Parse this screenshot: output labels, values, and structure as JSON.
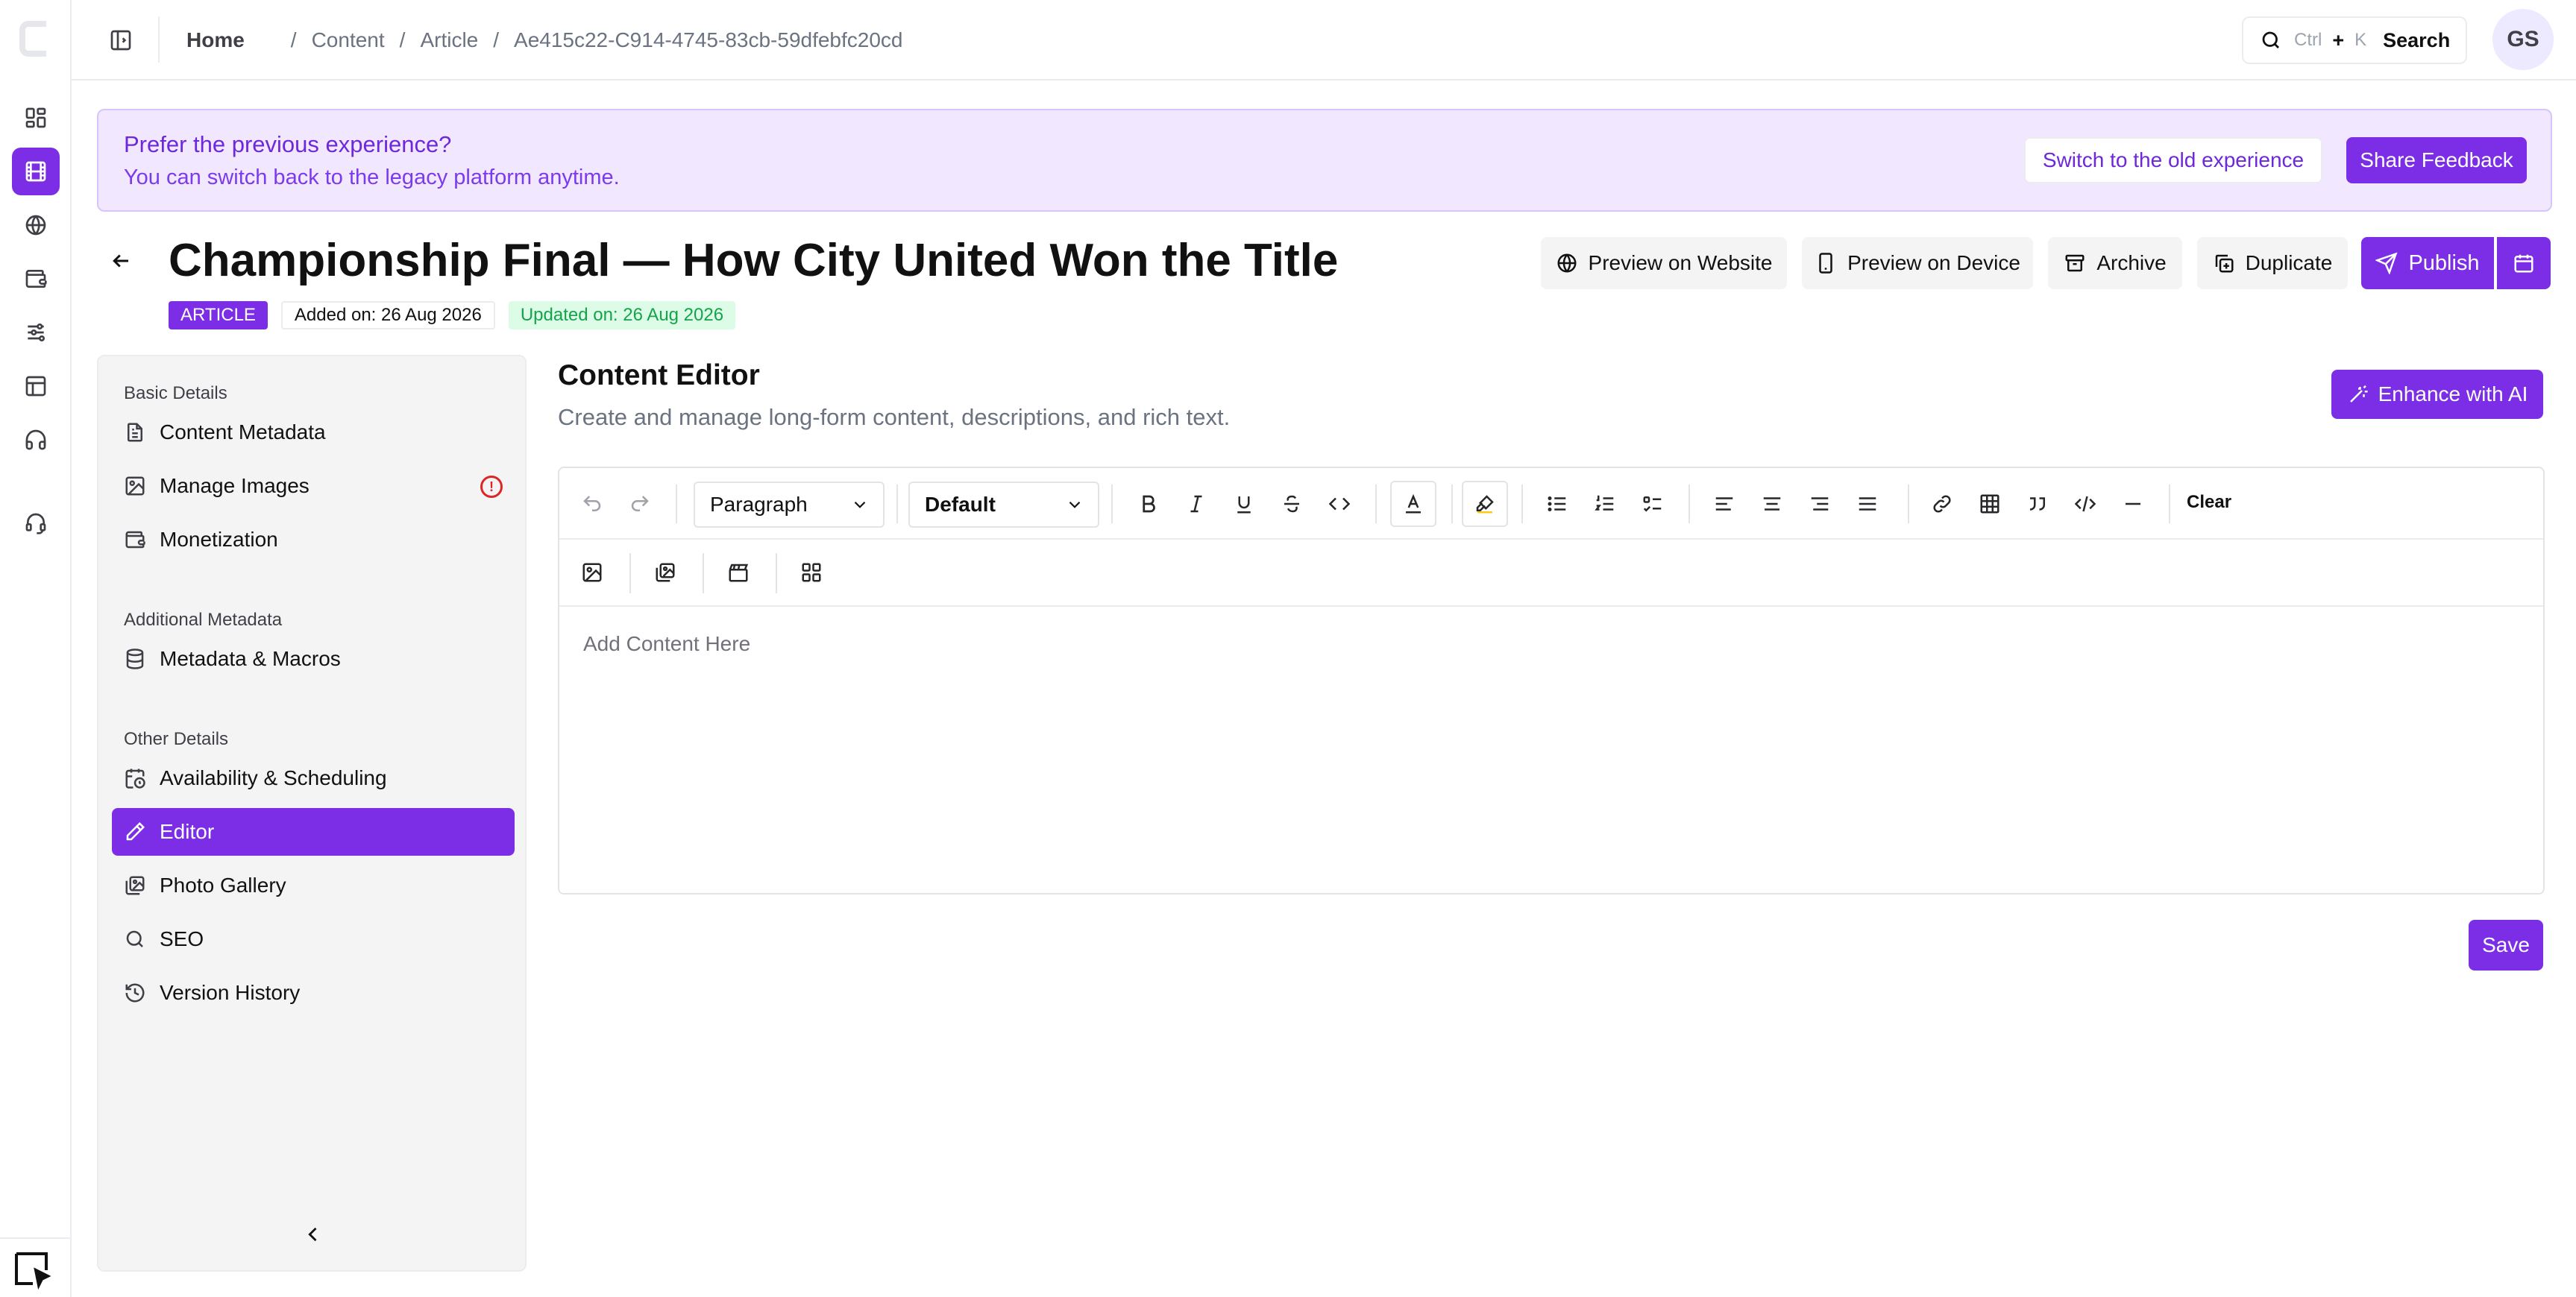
{
  "topbar": {
    "breadcrumb": [
      "Home",
      "Content",
      "Article",
      "Ae415c22-C914-4745-83cb-59dfebfc20cd"
    ],
    "search": {
      "key1": "Ctrl",
      "plus": "+",
      "key2": "K",
      "label": "Search"
    },
    "avatar_initials": "GS"
  },
  "banner": {
    "title": "Prefer the previous experience?",
    "subtitle": "You can switch back to the legacy platform anytime.",
    "switch_label": "Switch to the old experience",
    "feedback_label": "Share Feedback"
  },
  "page": {
    "title": "Championship Final — How City United Won the Title",
    "type_tag": "ARTICLE",
    "added": "Added on: 26 Aug 2026",
    "updated": "Updated on: 26 Aug 2026"
  },
  "actions": {
    "preview_website": "Preview on Website",
    "preview_device": "Preview on Device",
    "archive": "Archive",
    "duplicate": "Duplicate",
    "publish": "Publish"
  },
  "nav": {
    "basic_heading": "Basic Details",
    "basic": [
      "Content Metadata",
      "Manage Images",
      "Monetization"
    ],
    "additional_heading": "Additional Metadata",
    "additional": [
      "Metadata & Macros"
    ],
    "other_heading": "Other Details",
    "other": [
      "Availability & Scheduling",
      "Editor",
      "Photo Gallery",
      "SEO",
      "Version History"
    ],
    "active": "Editor",
    "warning_item": "Manage Images"
  },
  "editor": {
    "title": "Content Editor",
    "subtitle": "Create and manage long-form content, descriptions, and rich text.",
    "enhance_label": "Enhance with AI",
    "block_type": "Paragraph",
    "font": "Default",
    "clear_label": "Clear",
    "placeholder": "Add Content Here",
    "save_label": "Save"
  },
  "colors": {
    "accent": "#7c2ee6",
    "banner_bg": "#f1e8ff",
    "success": "#16a34a",
    "danger": "#dc2626"
  },
  "icons": {
    "rail": [
      "dashboard-icon",
      "film-icon",
      "globe-icon",
      "wallet-icon",
      "sliders-icon",
      "layout-icon",
      "headphones-icon",
      "support-icon"
    ],
    "toolbar": [
      "undo-icon",
      "redo-icon",
      "bold-icon",
      "italic-icon",
      "underline-icon",
      "strikethrough-icon",
      "inline-code-icon",
      "text-color-icon",
      "highlight-icon",
      "bullet-list-icon",
      "ordered-list-icon",
      "task-list-icon",
      "align-left-icon",
      "align-center-icon",
      "align-right-icon",
      "align-justify-icon",
      "link-icon",
      "table-icon",
      "quote-icon",
      "code-block-icon",
      "horizontal-rule-icon"
    ],
    "toolbar2": [
      "image-icon",
      "gallery-icon",
      "video-icon",
      "embed-grid-icon"
    ]
  }
}
